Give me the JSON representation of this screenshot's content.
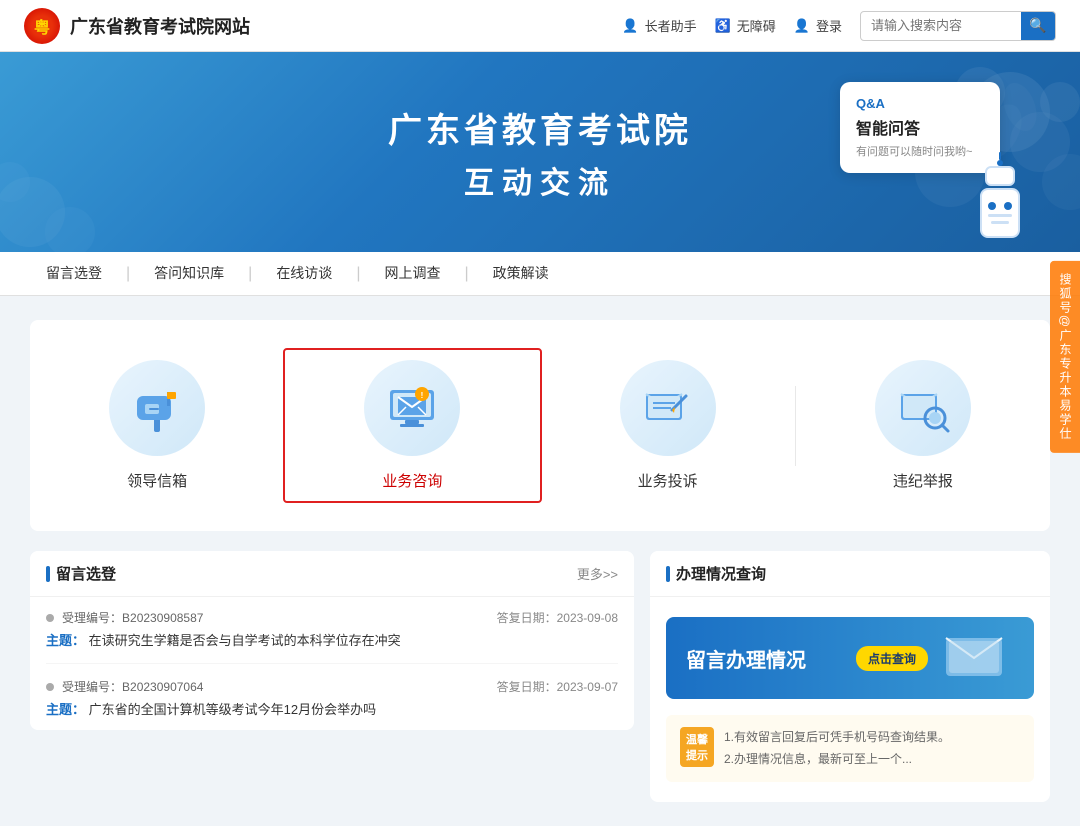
{
  "topNav": {
    "logo": "粤",
    "siteTitle": "广东省教育考试院网站",
    "elderHelper": "长者助手",
    "accessibility": "无障碍",
    "login": "登录",
    "searchPlaceholder": "请输入搜索内容"
  },
  "hero": {
    "title": "广东省教育考试院",
    "subtitle": "互动交流",
    "qaLabel": "Q&A",
    "qaTitle": "智能问答",
    "qaDesc": "有问题可以随时问我哟~"
  },
  "subNav": {
    "items": [
      "留言选登",
      "答问知识库",
      "在线访谈",
      "网上调查",
      "政策解读"
    ]
  },
  "iconGrid": {
    "items": [
      {
        "id": "leader-mailbox",
        "label": "领导信箱",
        "selected": false
      },
      {
        "id": "business-consult",
        "label": "业务咨询",
        "selected": true
      },
      {
        "id": "business-complaint",
        "label": "业务投诉",
        "selected": false
      },
      {
        "id": "violation-report",
        "label": "违纪举报",
        "selected": false
      }
    ]
  },
  "liuyanSection": {
    "title": "留言选登",
    "more": "更多>>",
    "items": [
      {
        "id": "B20230908587",
        "dateLabel": "答复日期：",
        "date": "2023-09-08",
        "topicLabel": "主题：",
        "topic": "在读研究生学籍是否会与自学考试的本科学位存在冲突"
      },
      {
        "id": "B20230907064",
        "dateLabel": "答复日期：",
        "date": "2023-09-07",
        "topicLabel": "主题：",
        "topic": "广东省的全国计算机等级考试今年12月份会举办吗"
      }
    ]
  },
  "banliSection": {
    "title": "办理情况查询",
    "highlightText": "留言办理情况",
    "highlightBtn": "点击查询",
    "tips": {
      "label": "温馨\n提示",
      "lines": [
        "1.有效留言回复后可凭手机号码查询结果。",
        "2.办理情况信息，最新可至上一个..."
      ]
    }
  },
  "watermark": {
    "line1": "搜狐号@广东专升本易学仕"
  }
}
